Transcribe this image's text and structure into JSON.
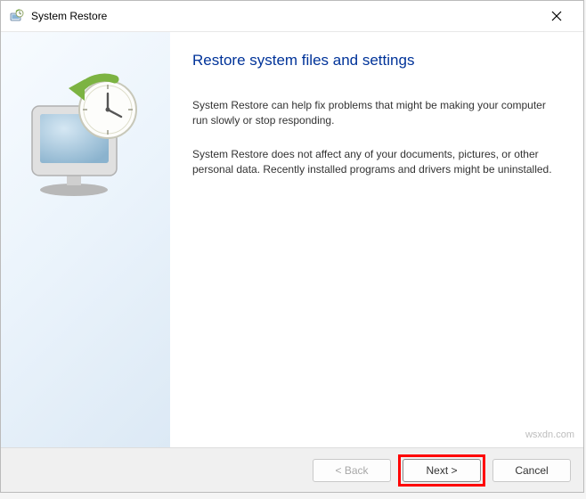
{
  "titlebar": {
    "title": "System Restore"
  },
  "main": {
    "heading": "Restore system files and settings",
    "paragraph1": "System Restore can help fix problems that might be making your computer run slowly or stop responding.",
    "paragraph2": "System Restore does not affect any of your documents, pictures, or other personal data. Recently installed programs and drivers might be uninstalled."
  },
  "footer": {
    "back_label": "< Back",
    "next_label": "Next >",
    "cancel_label": "Cancel"
  },
  "watermark": "wsxdn.com"
}
